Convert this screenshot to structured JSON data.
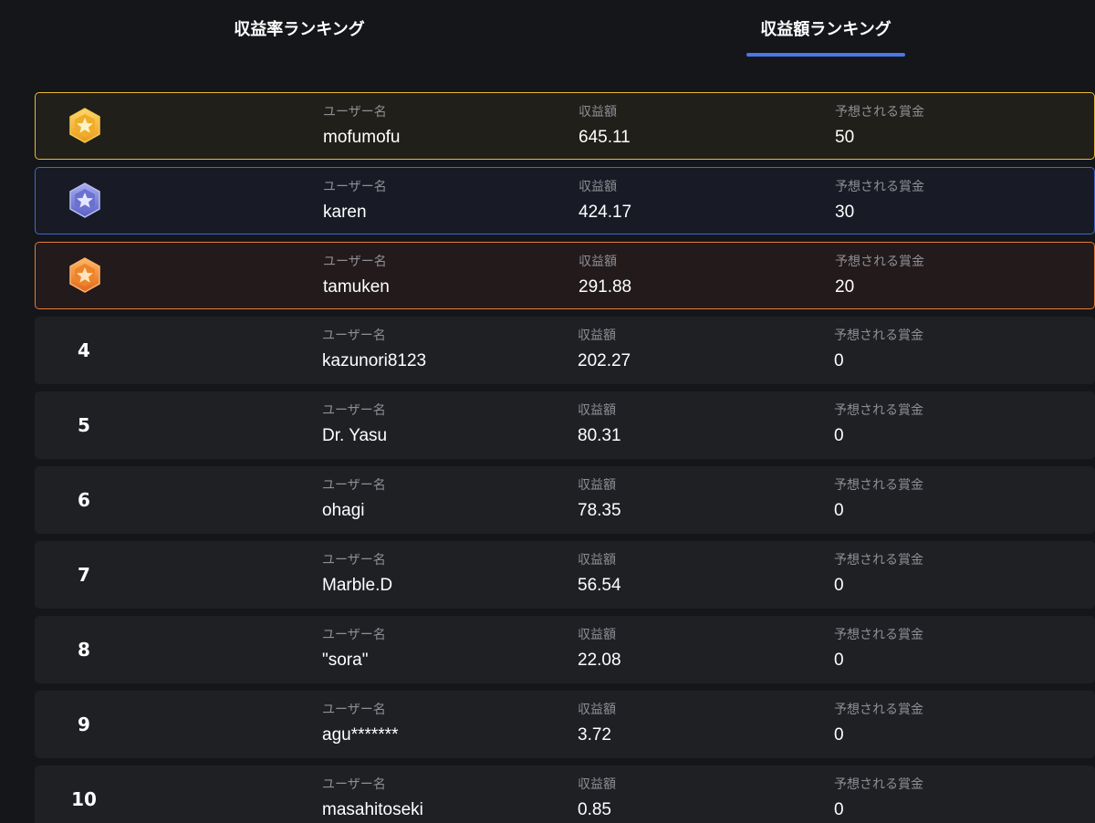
{
  "tabs": {
    "rate": "収益率ランキング",
    "amount": "収益額ランキング",
    "active": "amount"
  },
  "labels": {
    "user": "ユーザー名",
    "amount": "収益額",
    "prize": "予想される賞金"
  },
  "colors": {
    "accent": "#4a78e8",
    "gold": "#e8b93a",
    "silver": "#4566c9",
    "bronze": "#e57a36"
  },
  "rows": [
    {
      "rank": "1",
      "medal": "gold-medal-icon",
      "user": "mofumofu",
      "amount": "645.11",
      "prize": "50"
    },
    {
      "rank": "2",
      "medal": "silver-medal-icon",
      "user": "karen",
      "amount": "424.17",
      "prize": "30"
    },
    {
      "rank": "3",
      "medal": "bronze-medal-icon",
      "user": "tamuken",
      "amount": "291.88",
      "prize": "20"
    },
    {
      "rank": "4",
      "user": "kazunori8123",
      "amount": "202.27",
      "prize": "0"
    },
    {
      "rank": "5",
      "user": "Dr. Yasu",
      "amount": "80.31",
      "prize": "0"
    },
    {
      "rank": "6",
      "user": "ohagi",
      "amount": "78.35",
      "prize": "0"
    },
    {
      "rank": "7",
      "user": "Marble.D",
      "amount": "56.54",
      "prize": "0"
    },
    {
      "rank": "8",
      "user": "\"sora\"",
      "amount": "22.08",
      "prize": "0"
    },
    {
      "rank": "9",
      "user": "agu*******",
      "amount": "3.72",
      "prize": "0"
    },
    {
      "rank": "10",
      "user": "masahitoseki",
      "amount": "0.85",
      "prize": "0"
    }
  ]
}
